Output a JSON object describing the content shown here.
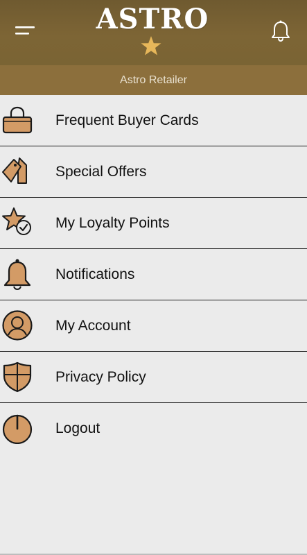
{
  "header": {
    "logo_text": "ASTRO",
    "retailer_name": "Astro Retailer"
  },
  "menu": {
    "items": [
      {
        "label": "Frequent Buyer Cards",
        "icon": "shopping-basket-icon"
      },
      {
        "label": "Special Offers",
        "icon": "tag-icon"
      },
      {
        "label": "My Loyalty Points",
        "icon": "star-check-icon"
      },
      {
        "label": "Notifications",
        "icon": "bell-icon"
      },
      {
        "label": "My Account",
        "icon": "user-icon"
      },
      {
        "label": "Privacy Policy",
        "icon": "shield-icon"
      },
      {
        "label": "Logout",
        "icon": "power-icon"
      }
    ]
  },
  "colors": {
    "header_bg": "#7a6434",
    "subbar_bg": "#8c6f3c",
    "icon_fill": "#d39b66",
    "star_gold": "#e7b75a",
    "page_bg": "#ebebeb"
  }
}
